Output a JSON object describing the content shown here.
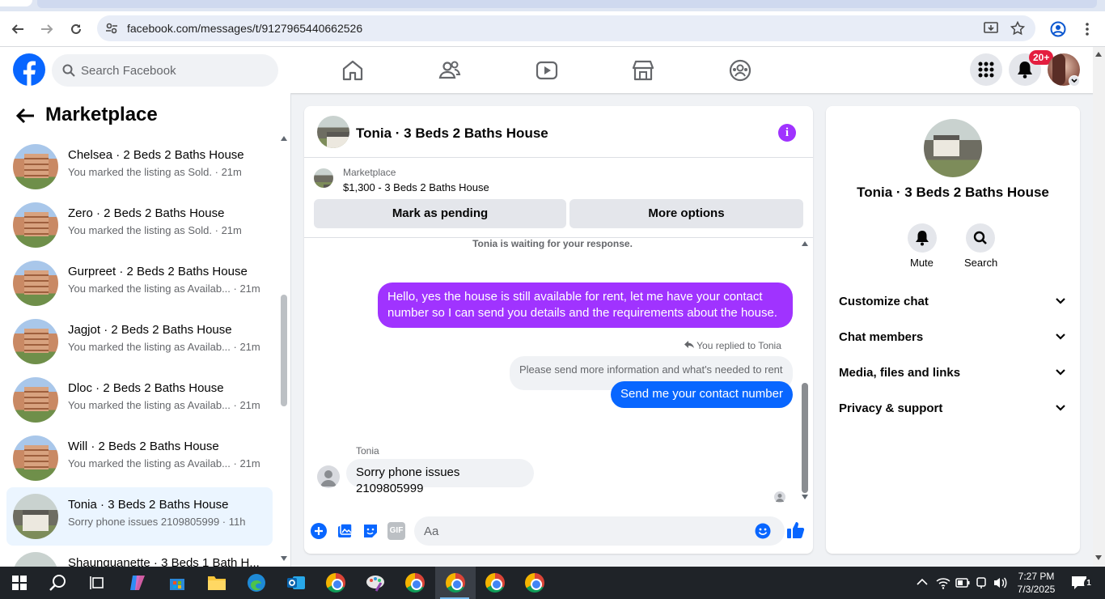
{
  "browser": {
    "url": "facebook.com/messages/t/9127965440662526"
  },
  "header": {
    "search_placeholder": "Search Facebook",
    "notif_badge": "20+",
    "nav_icons": [
      "home-icon",
      "friends-icon",
      "video-icon",
      "marketplace-icon",
      "groups-icon"
    ]
  },
  "left": {
    "title": "Marketplace",
    "conversations": [
      {
        "name": "Chelsea · 2 Beds 2 Baths House",
        "sub": "You marked the listing as Sold. · 21m"
      },
      {
        "name": "Zero · 2 Beds 2 Baths House",
        "sub": "You marked the listing as Sold. · 21m"
      },
      {
        "name": "Gurpreet · 2 Beds 2 Baths House",
        "sub": "You marked the listing as Availab... · 21m"
      },
      {
        "name": "Jagjot · 2 Beds 2 Baths House",
        "sub": "You marked the listing as Availab... · 21m"
      },
      {
        "name": "Dloc · 2 Beds 2 Baths House",
        "sub": "You marked the listing as Availab... · 21m"
      },
      {
        "name": "Will · 2 Beds 2 Baths House",
        "sub": "You marked the listing as Availab... · 21m"
      },
      {
        "name": "Tonia · 3 Beds 2 Baths House",
        "sub": "Sorry phone issues 2109805999 · 11h"
      },
      {
        "name": "Shaunquanette · 3 Beds 1 Bath H...",
        "sub": ""
      }
    ]
  },
  "chat": {
    "title": "Tonia · 3 Beds 2 Baths House",
    "marketplace_label": "Marketplace",
    "listing": "$1,300 - 3 Beds 2 Baths House",
    "mark_pending": "Mark as pending",
    "more_options": "More options",
    "waiting": "Tonia is waiting for your response.",
    "msg_sent_1": "Hello, yes the house is still available for rent, let me have your contact number so I can send you details and the requirements about the house.",
    "replied_to": "You replied to Tonia",
    "quoted": "Please send more information and what's needed to rent",
    "msg_sent_2": "Send me your contact number",
    "sender_label": "Tonia",
    "msg_received": "Sorry phone issues 2109805999",
    "composer_placeholder": "Aa",
    "gif_label": "GIF"
  },
  "right": {
    "name": "Tonia · 3 Beds 2 Baths House",
    "mute": "Mute",
    "search": "Search",
    "sections": [
      "Customize chat",
      "Chat members",
      "Media, files and links",
      "Privacy & support"
    ]
  },
  "taskbar": {
    "time": "7:27 PM",
    "date": "7/3/2025",
    "notif_count": "1"
  },
  "colors": {
    "fb_blue": "#0866ff",
    "purple": "#a033ff",
    "badge_red": "#e41e3f"
  }
}
